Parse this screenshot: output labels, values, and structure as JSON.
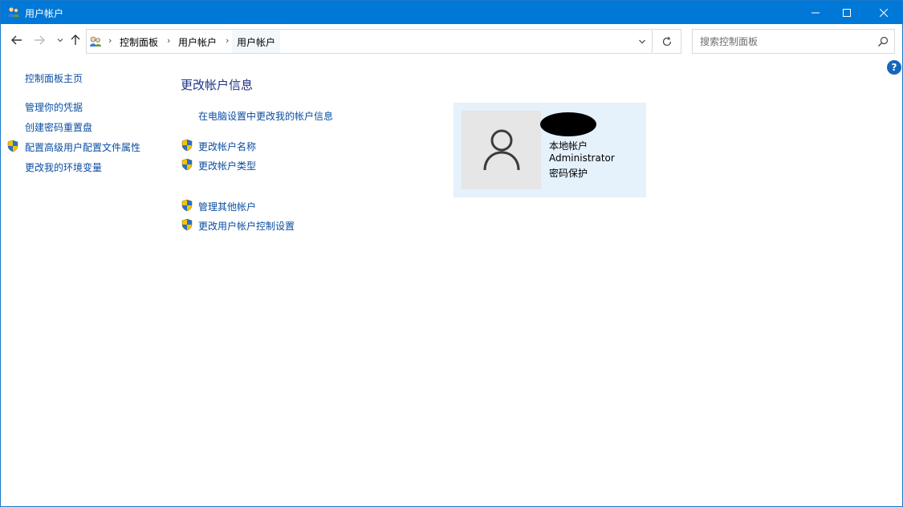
{
  "window": {
    "title": "用户帐户",
    "accent": "#0078d7",
    "controls": {
      "minimize": "minimize-icon",
      "maximize": "maximize-icon",
      "close": "close-icon"
    }
  },
  "nav": {
    "back": "arrow-left-icon",
    "forward": "arrow-right-icon",
    "recent": "chevron-down-icon",
    "up": "arrow-up-icon"
  },
  "address": {
    "breadcrumbs": [
      "控制面板",
      "用户帐户",
      "用户帐户"
    ],
    "separator": "›",
    "refresh_icon": "refresh-icon"
  },
  "search": {
    "placeholder": "搜索控制面板",
    "value": ""
  },
  "help": {
    "label": "?"
  },
  "sidebar": {
    "home": "控制面板主页",
    "items": [
      {
        "label": "管理你的凭据",
        "shield": false
      },
      {
        "label": "创建密码重置盘",
        "shield": false
      },
      {
        "label": "配置高级用户配置文件属性",
        "shield": true
      },
      {
        "label": "更改我的环境变量",
        "shield": false
      }
    ]
  },
  "main": {
    "heading": "更改帐户信息",
    "pc_settings_link": "在电脑设置中更改我的帐户信息",
    "links_group1": [
      {
        "label": "更改帐户名称",
        "shield": true
      },
      {
        "label": "更改帐户类型",
        "shield": true
      }
    ],
    "links_group2": [
      {
        "label": "管理其他帐户",
        "shield": true
      },
      {
        "label": "更改用户帐户控制设置",
        "shield": true
      }
    ]
  },
  "account": {
    "type": "本地帐户",
    "role": "Administrator",
    "protection": "密码保护",
    "card_color": "#e5f1fb"
  },
  "colors": {
    "link": "#0b4ea2",
    "heading": "#1e3287"
  }
}
